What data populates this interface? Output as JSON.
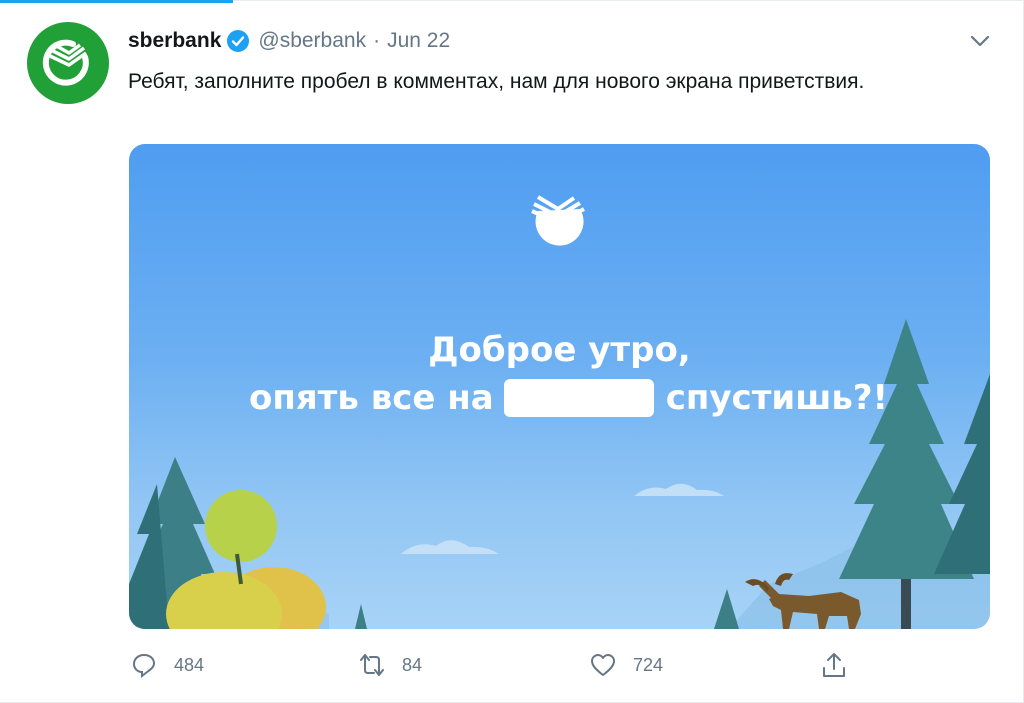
{
  "tweet": {
    "display_name": "sberbank",
    "handle": "@sberbank",
    "separator": "·",
    "date": "Jun 22",
    "text": "Ребят, заполните пробел в комментах, нам для нового экрана приветствия."
  },
  "media": {
    "headline_line1": "Доброе утро,",
    "headline_line2_before": "опять все на",
    "headline_line2_after": "спустишь?!"
  },
  "actions": {
    "replies": "484",
    "retweets": "84",
    "likes": "724"
  },
  "icons": {
    "avatar": "sberbank-logo-icon",
    "verified": "verified-badge-icon",
    "menu": "chevron-down-icon",
    "reply": "reply-icon",
    "retweet": "retweet-icon",
    "like": "heart-icon",
    "share": "share-icon"
  },
  "colors": {
    "brand_green": "#21a038",
    "twitter_blue": "#1da1f2",
    "muted_text": "#657786"
  }
}
